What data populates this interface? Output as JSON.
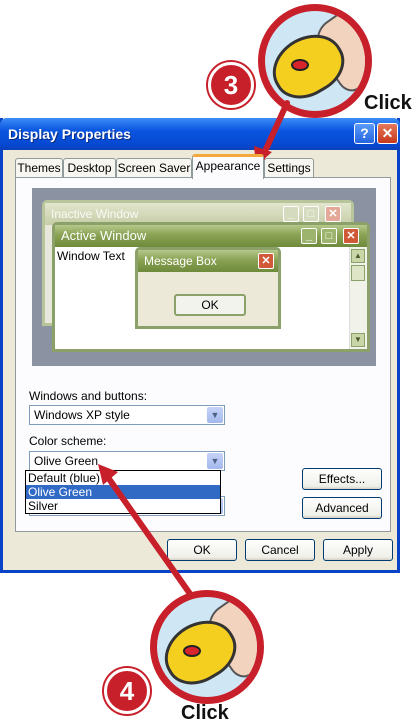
{
  "callouts": {
    "step3": {
      "number": "3",
      "label": "Click"
    },
    "step4": {
      "number": "4",
      "label": "Click"
    }
  },
  "dialog": {
    "title": "Display Properties",
    "help_glyph": "?",
    "close_glyph": "✕",
    "tabs": [
      "Themes",
      "Desktop",
      "Screen Saver",
      "Appearance",
      "Settings"
    ],
    "active_tab": "Appearance",
    "preview": {
      "inactive_title": "Inactive Window",
      "active_title": "Active Window",
      "window_text": "Window Text",
      "message_title": "Message Box",
      "ok_label": "OK",
      "min_glyph": "_",
      "max_glyph": "□",
      "close_glyph": "✕"
    },
    "windows_buttons_label": "Windows and buttons:",
    "windows_buttons_value": "Windows XP style",
    "color_scheme_label": "Color scheme:",
    "color_scheme_value": "Olive Green",
    "color_scheme_options": [
      "Default (blue)",
      "Olive Green",
      "Silver"
    ],
    "selected_option": "Olive Green",
    "effects_label": "Effects...",
    "advanced_label": "Advanced",
    "ok_label": "OK",
    "cancel_label": "Cancel",
    "apply_label": "Apply",
    "dropdown_arrow": "▼"
  },
  "colors": {
    "callout_red": "#c8202a",
    "xp_blue_title": "#0a55e0",
    "olive_title": "#8aa254",
    "selection": "#316ac5"
  }
}
